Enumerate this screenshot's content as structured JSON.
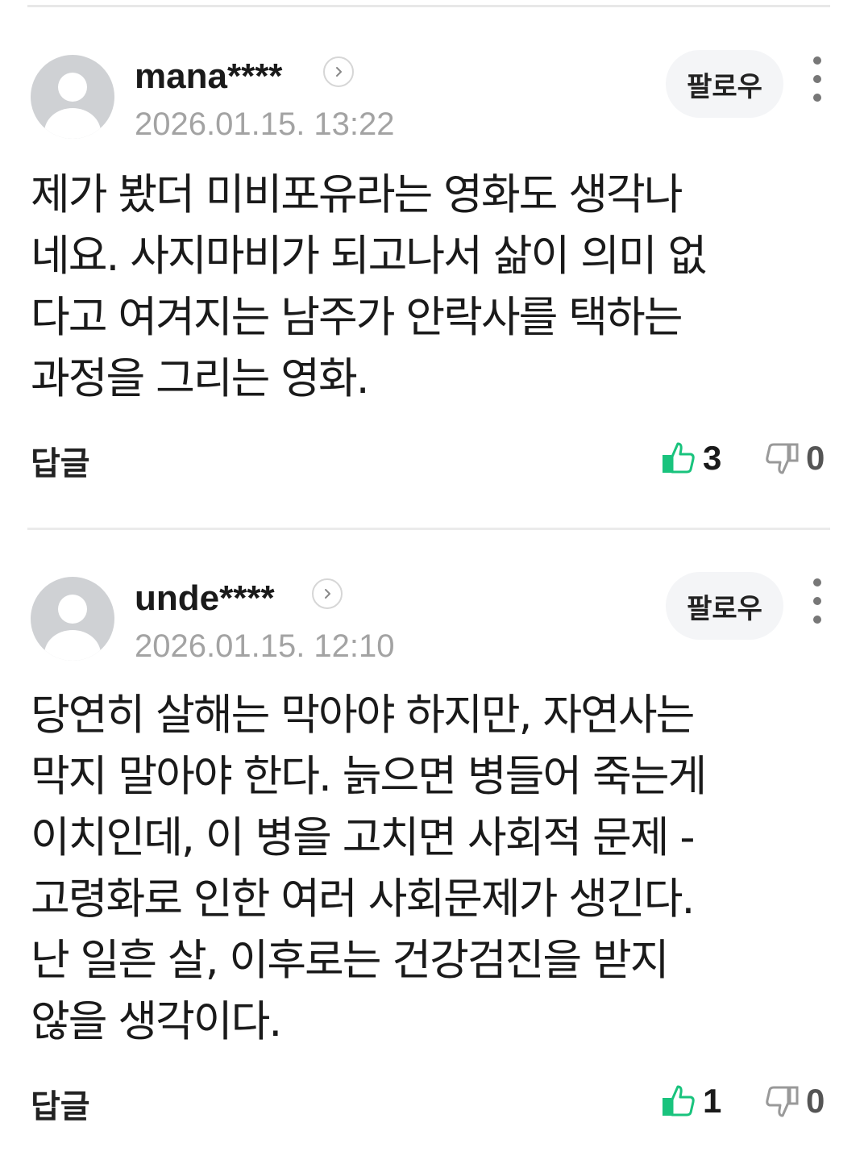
{
  "comments": [
    {
      "username": "mana****",
      "timestamp": "2026.01.15. 13:22",
      "follow_label": "팔로우",
      "body_lines": [
        "제가 봤더 미비포유라는 영화도 생각나",
        "네요. 사지마비가 되고나서 삶이 의미 없",
        "다고 여겨지는 남주가 안락사를 택하는",
        "과정을 그리는 영화."
      ],
      "reply_label": "답글",
      "likes": "3",
      "dislikes": "0"
    },
    {
      "username": "unde****",
      "timestamp": "2026.01.15. 12:10",
      "follow_label": "팔로우",
      "body_lines": [
        "당연히 살해는 막아야 하지만, 자연사는",
        "막지 말아야 한다. 늙으면 병들어 죽는게",
        "이치인데, 이 병을 고치면 사회적 문제 -",
        "고령화로 인한 여러 사회문제가 생긴다.",
        "난 일흔 살, 이후로는 건강검진을 받지",
        "않을 생각이다."
      ],
      "reply_label": "답글",
      "likes": "1",
      "dislikes": "0"
    }
  ],
  "icons": {
    "avatar": "default-user-avatar",
    "profile_link": "chevron-right-icon",
    "more": "vertical-dots-icon",
    "like": "thumbs-up-icon",
    "dislike": "thumbs-down-icon"
  },
  "colors": {
    "like_accent": "#19c37d",
    "timestamp": "#a3a3a3",
    "divider": "#ebebeb",
    "follow_bg": "#f4f5f7"
  }
}
